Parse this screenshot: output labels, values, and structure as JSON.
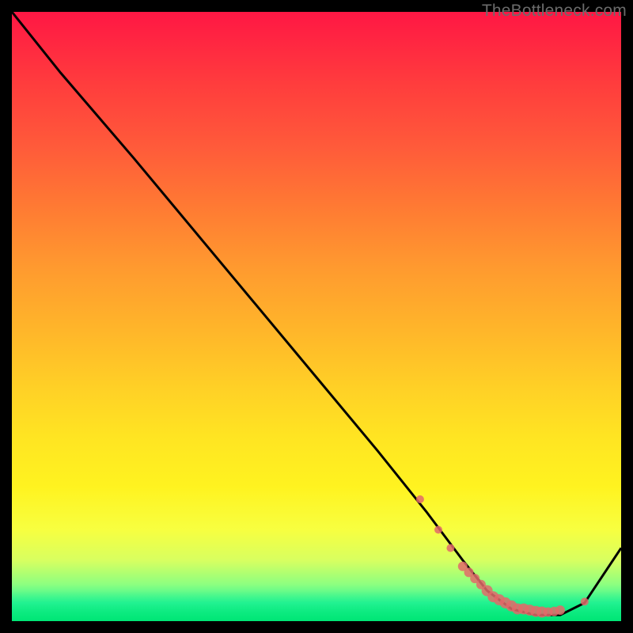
{
  "attribution": "TheBottleneck.com",
  "colors": {
    "gradient_top": "#ff1744",
    "gradient_bottom": "#00e676",
    "curve": "#000000",
    "markers": "#e26a6a"
  },
  "chart_data": {
    "type": "line",
    "title": "",
    "xlabel": "",
    "ylabel": "",
    "xlim": [
      0,
      100
    ],
    "ylim": [
      0,
      100
    ],
    "series": [
      {
        "name": "bottleneck-curve",
        "x": [
          0,
          8,
          20,
          30,
          40,
          50,
          60,
          68,
          74,
          78,
          82,
          86,
          90,
          94,
          100
        ],
        "y": [
          100,
          90,
          76,
          64,
          52,
          40,
          28,
          18,
          10,
          5,
          2,
          1,
          1,
          3,
          12
        ]
      }
    ],
    "markers": {
      "name": "confidence-dots",
      "x": [
        67,
        70,
        72,
        74,
        75,
        76,
        77,
        78,
        79,
        80,
        81,
        82,
        83,
        84,
        85,
        86,
        87,
        88,
        89,
        90,
        94
      ],
      "y": [
        20,
        15,
        12,
        9,
        8,
        7,
        6,
        5,
        4,
        3.5,
        3,
        2.5,
        2,
        2,
        1.8,
        1.6,
        1.5,
        1.5,
        1.6,
        1.8,
        3.2
      ],
      "r": [
        5,
        5,
        5,
        6,
        6,
        6,
        6,
        7,
        7,
        7,
        7,
        7,
        7,
        7,
        7,
        7,
        7,
        6,
        6,
        6,
        5
      ]
    }
  }
}
